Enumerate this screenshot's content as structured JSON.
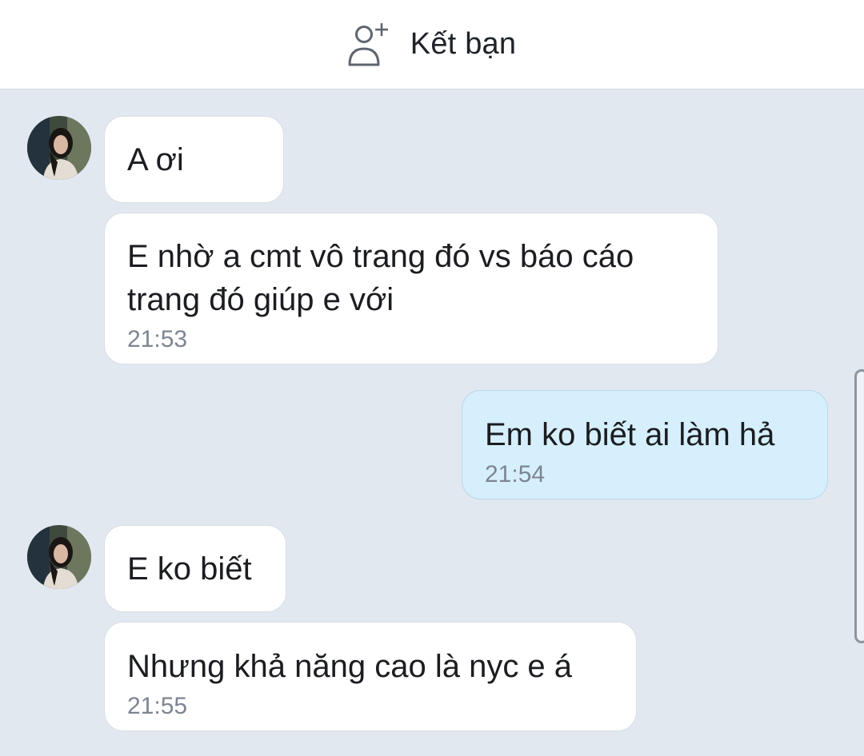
{
  "header": {
    "add_friend_label": "Kết bạn",
    "icon": "add-user-icon"
  },
  "messages": [
    {
      "sender": "other",
      "text": "A ơi",
      "time": ""
    },
    {
      "sender": "other",
      "text": "E nhờ a cmt vô trang đó vs báo cáo\ntrang đó giúp e với",
      "time": "21:53"
    },
    {
      "sender": "me",
      "text": "Em ko biết ai làm hả",
      "time": "21:54"
    },
    {
      "sender": "other",
      "text": "E ko biết",
      "time": ""
    },
    {
      "sender": "other",
      "text": "Nhưng khả năng cao là nyc e á",
      "time": "21:55"
    }
  ],
  "colors": {
    "chat_background": "#e2e8f0",
    "incoming_bubble": "#ffffff",
    "outgoing_bubble": "#d6effd",
    "timestamp": "#7d8590"
  }
}
